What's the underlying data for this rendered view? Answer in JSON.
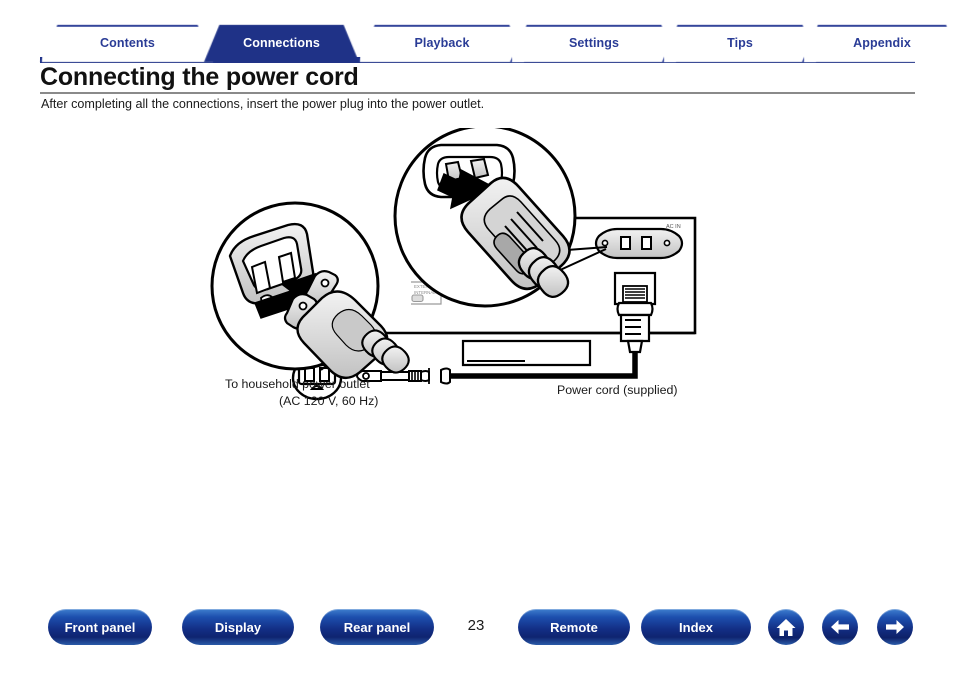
{
  "tabs": [
    {
      "label": "Contents",
      "active": false
    },
    {
      "label": "Connections",
      "active": true
    },
    {
      "label": "Playback",
      "active": false
    },
    {
      "label": "Settings",
      "active": false
    },
    {
      "label": "Tips",
      "active": false
    },
    {
      "label": "Appendix",
      "active": false
    }
  ],
  "page": {
    "title": "Connecting the power cord",
    "subtitle": "After completing all the connections, insert the power plug into the power outlet.",
    "number": "23"
  },
  "diagram": {
    "label_outlet_line1": "To household power outlet",
    "label_outlet_line2": "(AC 120 V, 60 Hz)",
    "label_cord": "Power cord (supplied)",
    "rear_panel_ac_label": "AC IN",
    "rear_panel_switch_label_1": "EXTERNAL",
    "rear_panel_switch_label_2": "INTERNAL"
  },
  "bottom_nav": {
    "front_panel": "Front panel",
    "display": "Display",
    "rear_panel": "Rear panel",
    "remote": "Remote",
    "index": "Index",
    "home_icon": "home-icon",
    "back_icon": "arrow-left-icon",
    "forward_icon": "arrow-right-icon"
  },
  "colors": {
    "brand_blue": "#1f3287",
    "tab_text_blue": "#2a3c96",
    "rule_gray": "#8a8a8a"
  }
}
